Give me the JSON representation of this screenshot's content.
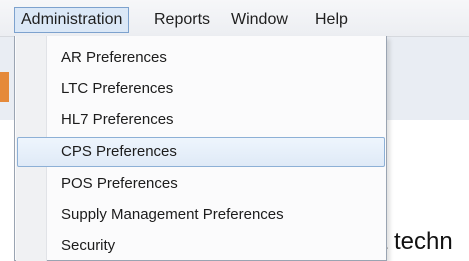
{
  "menubar": {
    "items": [
      {
        "label": "Administration"
      },
      {
        "label": "Reports"
      },
      {
        "label": "Window"
      },
      {
        "label": "Help"
      }
    ]
  },
  "dropdown": {
    "items": [
      {
        "label": "AR Preferences"
      },
      {
        "label": "LTC Preferences"
      },
      {
        "label": "HL7 Preferences"
      },
      {
        "label": "CPS Preferences",
        "highlighted": true
      },
      {
        "label": "POS Preferences"
      },
      {
        "label": "Supply Management Preferences"
      },
      {
        "label": "Security"
      }
    ]
  },
  "background": {
    "text": "a techn"
  },
  "colors": {
    "menu_highlight": "#dfeaf7",
    "menu_highlight_border": "#8db0d6",
    "accent": "#e58a3a"
  }
}
